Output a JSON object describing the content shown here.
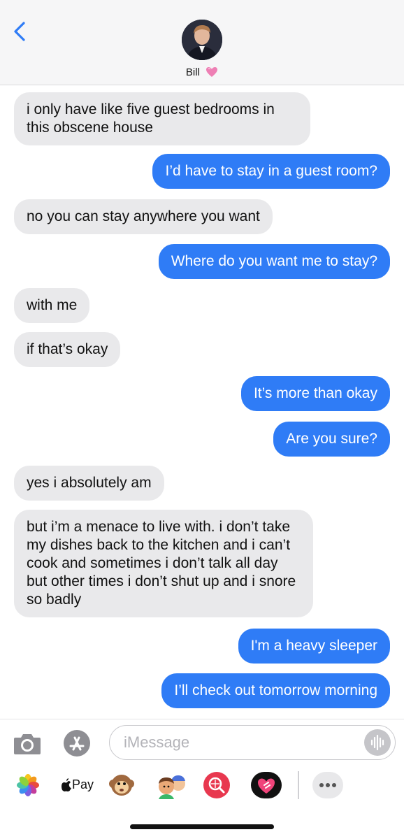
{
  "contact": {
    "name": "Bill"
  },
  "composer": {
    "placeholder": "iMessage"
  },
  "apps": {
    "pay_label": "Pay"
  },
  "messages": [
    {
      "side": "received",
      "text": "i only have like five guest bedrooms in this obscene house"
    },
    {
      "side": "sent",
      "text": "I’d have to stay in a guest room?"
    },
    {
      "side": "received",
      "text": "no you can stay anywhere you want"
    },
    {
      "side": "sent",
      "text": "Where do you want me to stay?"
    },
    {
      "side": "received",
      "text": "with me"
    },
    {
      "side": "received",
      "text": "if that’s okay"
    },
    {
      "side": "sent",
      "text": "It’s more than okay"
    },
    {
      "side": "sent",
      "text": "Are you sure?"
    },
    {
      "side": "received",
      "text": "yes i absolutely am"
    },
    {
      "side": "received",
      "text": "but i’m a menace to live with. i don’t take my dishes back to the kitchen and i can’t cook and sometimes i don’t talk all day but other times i don’t shut up and i snore so badly"
    },
    {
      "side": "sent",
      "text": "I'm a heavy sleeper"
    },
    {
      "side": "sent",
      "text": "I’ll check out tomorrow morning"
    }
  ],
  "colors": {
    "sent_bubble": "#2f7cf6",
    "received_bubble": "#e9e9eb",
    "ios_blue": "#2f7cf6"
  },
  "icons": [
    "back-chevron-icon",
    "heart-emoji-icon",
    "camera-icon",
    "app-store-icon",
    "audio-waveform-icon",
    "photos-icon",
    "apple-logo-icon",
    "monkey-emoji-icon",
    "memoji-icon",
    "image-search-icon",
    "digital-touch-icon",
    "more-icon"
  ]
}
